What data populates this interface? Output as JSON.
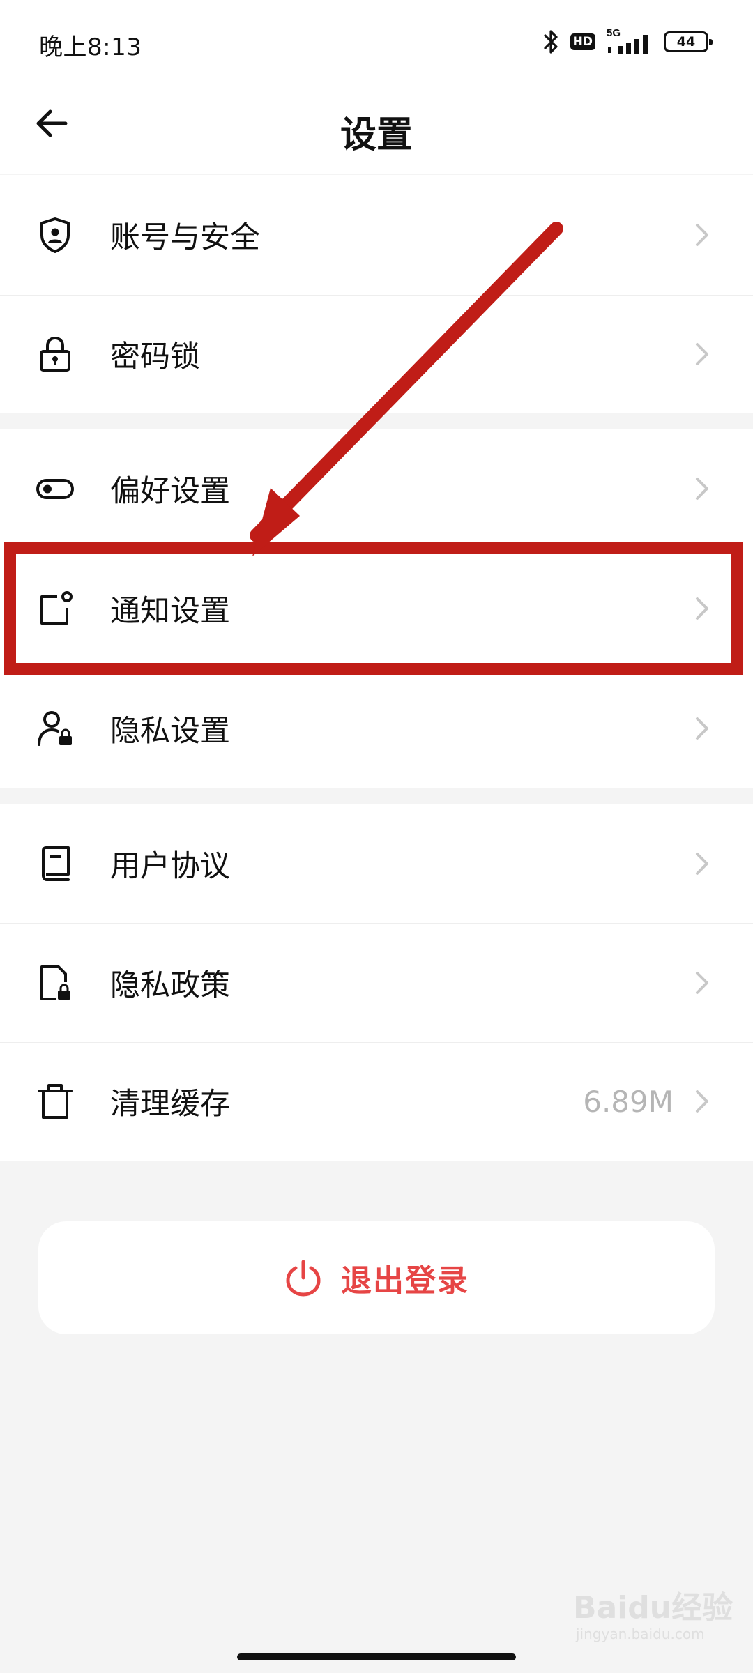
{
  "status_bar": {
    "time": "晚上8:13",
    "network": "5G",
    "hd": "HD",
    "battery": "44",
    "icons": [
      "bluetooth-icon",
      "hd-icon",
      "signal-icon",
      "battery-icon"
    ]
  },
  "header": {
    "title": "设置",
    "back_icon": "arrow-left-icon"
  },
  "groups": [
    {
      "items": [
        {
          "label": "账号与安全",
          "icon": "shield-user-icon"
        },
        {
          "label": "密码锁",
          "icon": "lock-icon"
        }
      ]
    },
    {
      "items": [
        {
          "label": "偏好设置",
          "icon": "toggle-icon"
        },
        {
          "label": "通知设置",
          "icon": "notification-icon"
        },
        {
          "label": "隐私设置",
          "icon": "user-lock-icon"
        }
      ]
    },
    {
      "items": [
        {
          "label": "用户协议",
          "icon": "book-icon"
        },
        {
          "label": "隐私政策",
          "icon": "document-lock-icon"
        },
        {
          "label": "清理缓存",
          "icon": "trash-icon",
          "value": "6.89M"
        }
      ]
    }
  ],
  "logout": {
    "label": "退出登录",
    "icon": "power-icon"
  },
  "watermark": {
    "text": "Baidu经验",
    "sub": "jingyan.baidu.com"
  },
  "colors": {
    "accent_red": "#e64545",
    "annotation_red": "#c01d17",
    "background": "#f4f4f4",
    "chevron": "#c8c8c8"
  }
}
